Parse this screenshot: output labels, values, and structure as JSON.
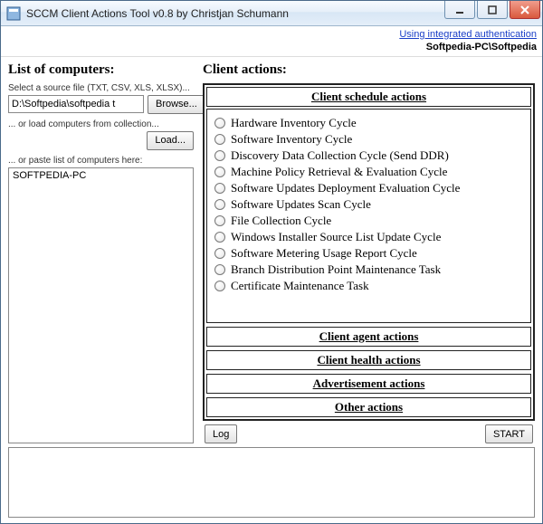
{
  "window": {
    "title": "SCCM Client Actions Tool v0.8 by Christjan Schumann"
  },
  "toplinks": {
    "auth_link": "Using integrated authentication",
    "identity": "Softpedia-PC\\Softpedia"
  },
  "left": {
    "heading": "List of computers:",
    "source_label": "Select a source file (TXT, CSV, XLS, XLSX)...",
    "source_value": "D:\\Softpedia\\softpedia t",
    "browse_btn": "Browse...",
    "collection_label": "... or load computers from collection...",
    "load_btn": "Load...",
    "paste_label": "... or paste list of computers here:",
    "paste_value": "SOFTPEDIA-PC"
  },
  "right": {
    "heading": "Client actions:",
    "sections": {
      "schedule": "Client schedule actions",
      "agent": "Client agent actions",
      "health": "Client health actions",
      "advertisement": "Advertisement actions",
      "other": "Other actions"
    },
    "schedule_items": [
      "Hardware Inventory Cycle",
      "Software Inventory Cycle",
      "Discovery Data Collection Cycle (Send DDR)",
      "Machine Policy Retrieval & Evaluation Cycle",
      "Software Updates Deployment Evaluation Cycle",
      "Software Updates Scan Cycle",
      "File Collection Cycle",
      "Windows Installer Source List Update Cycle",
      "Software Metering Usage Report Cycle",
      "Branch Distribution Point Maintenance Task",
      "Certificate Maintenance Task"
    ],
    "log_btn": "Log",
    "start_btn": "START"
  }
}
